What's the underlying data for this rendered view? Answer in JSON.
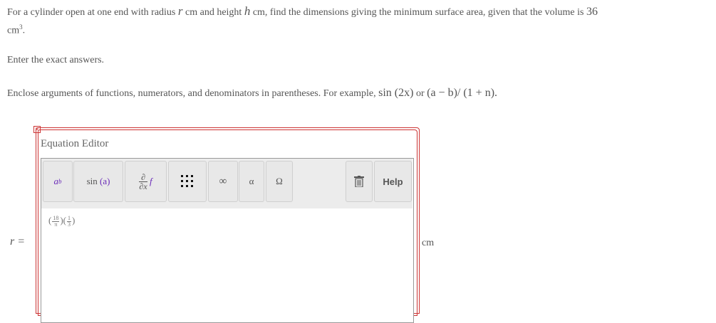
{
  "question": {
    "p1_a": "For a cylinder open at one end with radius",
    "var_r": "r",
    "p1_b": "cm and height",
    "var_h": "h",
    "p1_c": "cm, find the dimensions giving the minimum surface area, given that the volume is",
    "volume": "36",
    "unit_cm": "cm",
    "unit_exp": "3",
    "unit_end": ".",
    "instruction": "Enter the exact answers.",
    "enclose_a": "Enclose arguments of functions, numerators, and denominators in parentheses. For example,",
    "example1": "sin (2x)",
    "or": "or",
    "example2": "(a − b)/ (1 + n)."
  },
  "answer": {
    "label": "r =",
    "unit": "cm",
    "close_symbol": "×"
  },
  "editor": {
    "title": "Equation Editor",
    "buttons": {
      "power_base": "a",
      "power_exp": "b",
      "func_name": "sin",
      "func_arg": "(a)",
      "deriv_top": "∂",
      "deriv_bottom": "∂x",
      "deriv_f": "f",
      "infinity": "∞",
      "alpha": "α",
      "omega": "Ω",
      "help": "Help"
    },
    "icons": [
      "matrix-icon",
      "trash-icon"
    ],
    "expression": {
      "frac1_num": "18",
      "frac1_den": "π",
      "frac2_num": "1",
      "frac2_den": "3"
    }
  }
}
